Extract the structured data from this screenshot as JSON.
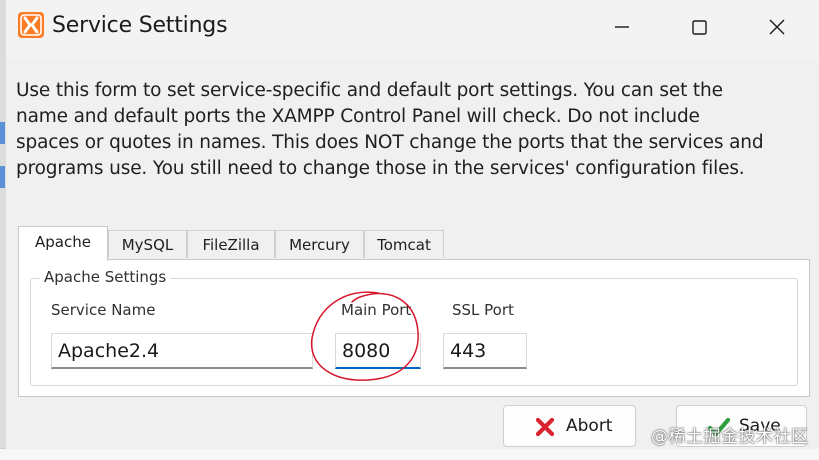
{
  "dialog": {
    "title": "Service Settings",
    "icon": "xampp-logo-icon",
    "controls": [
      "minimize-icon",
      "maximize-icon",
      "close-icon"
    ]
  },
  "description_lines": [
    "Use this form to set service-specific and default port settings.  You can set the",
    "name and default ports the XAMPP Control Panel will check.  Do not include",
    "spaces or quotes in names.  This does NOT change the ports that the services and",
    "programs use.  You still need to change those in the services' configuration files."
  ],
  "tabs": [
    "Apache",
    "MySQL",
    "FileZilla",
    "Mercury",
    "Tomcat"
  ],
  "active_tab": "Apache",
  "panel": {
    "group_title": "Apache Settings",
    "service_name_label": "Service Name",
    "service_name_value": "Apache2.4",
    "main_port_label": "Main Port",
    "main_port_value": "8080",
    "ssl_port_label": "SSL Port",
    "ssl_port_value": "443"
  },
  "buttons": {
    "abort_label": "Abort",
    "save_label": "Save"
  },
  "watermark": "@稀土掘金技术社区",
  "colors": {
    "accent": "#0067c0",
    "annotation": "#d4182a",
    "abort_icon": "#d9232e",
    "save_icon": "#2e9e3e",
    "app_icon": "#fb7a24"
  }
}
